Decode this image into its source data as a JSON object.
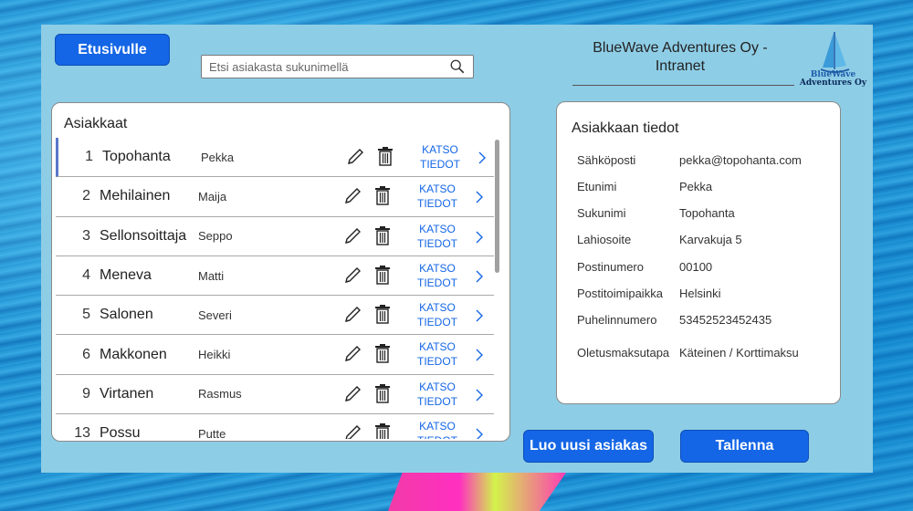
{
  "header": {
    "home_label": "Etusivulle",
    "search_placeholder": "Etsi asiakasta sukunimellä",
    "company_line1": "BlueWave Adventures Oy -",
    "company_line2": "Intranet",
    "logo_line1": "BlueWave",
    "logo_line2": "Adventures Oy"
  },
  "customers": {
    "title": "Asiakkaat",
    "view_label_1": "KATSO",
    "view_label_2": "TIEDOT",
    "rows": [
      {
        "id": "1",
        "surname": "Topohanta",
        "first": "Pekka"
      },
      {
        "id": "2",
        "surname": "Mehilainen",
        "first": "Maija"
      },
      {
        "id": "3",
        "surname": "Sellonsoittaja",
        "first": "Seppo"
      },
      {
        "id": "4",
        "surname": "Meneva",
        "first": "Matti"
      },
      {
        "id": "5",
        "surname": "Salonen",
        "first": "Severi"
      },
      {
        "id": "6",
        "surname": "Makkonen",
        "first": "Heikki"
      },
      {
        "id": "9",
        "surname": "Virtanen",
        "first": "Rasmus"
      },
      {
        "id": "13",
        "surname": "Possu",
        "first": "Putte"
      }
    ]
  },
  "details": {
    "title": "Asiakkaan tiedot",
    "fields": [
      {
        "label": "Sähköposti",
        "value": "pekka@topohanta.com"
      },
      {
        "label": "Etunimi",
        "value": "Pekka"
      },
      {
        "label": "Sukunimi",
        "value": "Topohanta"
      },
      {
        "label": "Lahiosoite",
        "value": "Karvakuja 5"
      },
      {
        "label": "Postinumero",
        "value": "00100"
      },
      {
        "label": "Postitoimipaikka",
        "value": "Helsinki"
      },
      {
        "label": "Puhelinnumero",
        "value": "53452523452435"
      },
      {
        "label": "Oletusmaksutapa",
        "value": "Käteinen / Korttimaksu"
      }
    ]
  },
  "actions": {
    "new_label": "Luo uusi asiakas",
    "save_label": "Tallenna"
  },
  "colors": {
    "accent": "#1466e6",
    "panel": "#8ecde6"
  }
}
